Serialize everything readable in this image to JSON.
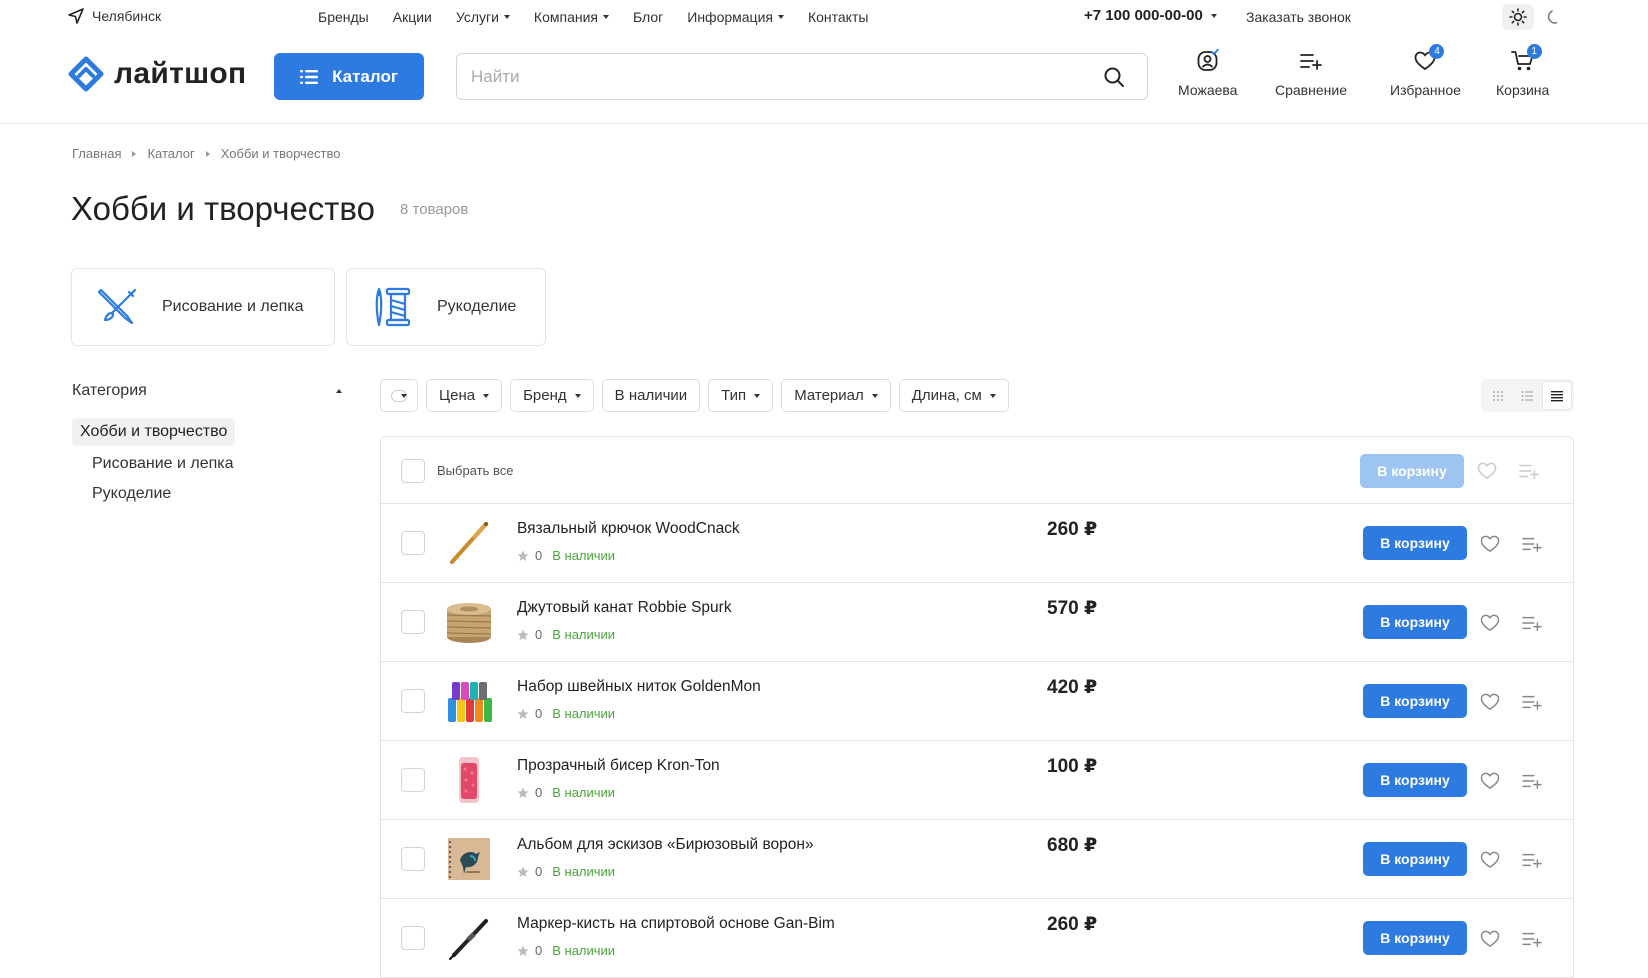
{
  "topbar": {
    "city": "Челябинск",
    "nav": [
      {
        "label": "Бренды",
        "dropdown": false
      },
      {
        "label": "Акции",
        "dropdown": false
      },
      {
        "label": "Услуги",
        "dropdown": true
      },
      {
        "label": "Компания",
        "dropdown": true
      },
      {
        "label": "Блог",
        "dropdown": false
      },
      {
        "label": "Информация",
        "dropdown": true
      },
      {
        "label": "Контакты",
        "dropdown": false
      }
    ],
    "phone": "+7 100 000-00-00",
    "callback": "Заказать звонок"
  },
  "header": {
    "logo": "лайтшоп",
    "catalog_label": "Каталог",
    "search_placeholder": "Найти",
    "user": "Можаева",
    "compare": "Сравнение",
    "favorites": "Избранное",
    "favorites_count": "4",
    "cart": "Корзина",
    "cart_count": "1"
  },
  "breadcrumb": [
    "Главная",
    "Каталог",
    "Хобби и творчество"
  ],
  "page": {
    "title": "Хобби и творчество",
    "count": "8 товаров"
  },
  "subcategories": [
    "Рисование и лепка",
    "Рукоделие"
  ],
  "sidebar": {
    "heading": "Категория",
    "active": "Хобби и творчество",
    "items": [
      "Рисование и лепка",
      "Рукоделие"
    ]
  },
  "filters": [
    "Цена",
    "Бренд",
    "В наличии",
    "Тип",
    "Материал",
    "Длина, см"
  ],
  "filters_dropdown": [
    true,
    true,
    false,
    true,
    true,
    true
  ],
  "list": {
    "select_all": "Выбрать все",
    "to_basket": "В корзину",
    "products": [
      {
        "name": "Вязальный крючок WoodCnack",
        "rating": "0",
        "stock": "В наличии",
        "price": "260 ₽",
        "icon": "crochet-hook-icon"
      },
      {
        "name": "Джутовый канат Robbie Spurk",
        "rating": "0",
        "stock": "В наличии",
        "price": "570 ₽",
        "icon": "jute-rope-icon"
      },
      {
        "name": "Набор швейных ниток GoldenMon",
        "rating": "0",
        "stock": "В наличии",
        "price": "420 ₽",
        "icon": "thread-set-icon"
      },
      {
        "name": "Прозрачный бисер Kron-Ton",
        "rating": "0",
        "stock": "В наличии",
        "price": "100 ₽",
        "icon": "beads-icon"
      },
      {
        "name": "Альбом для эскизов «Бирюзовый ворон»",
        "rating": "0",
        "stock": "В наличии",
        "price": "680 ₽",
        "icon": "sketchbook-icon"
      },
      {
        "name": "Маркер-кисть на спиртовой основе Gan-Bim",
        "rating": "0",
        "stock": "В наличии",
        "price": "260 ₽",
        "icon": "marker-icon"
      }
    ]
  },
  "colors": {
    "accent": "#2d7ae0",
    "accent_disabled": "#9ec4f2",
    "in_stock": "#4aa63a"
  }
}
